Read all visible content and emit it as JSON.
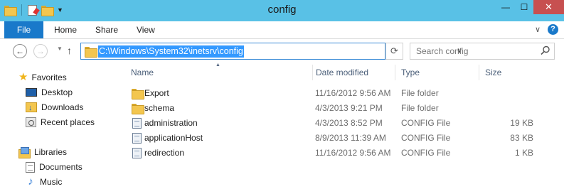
{
  "window": {
    "title": "config",
    "minimize": "—",
    "maximize": "☐",
    "close": "✕"
  },
  "ribbon": {
    "tabs": [
      "File",
      "Home",
      "Share",
      "View"
    ],
    "expand_icon": "chevron-down-icon",
    "help_label": "?"
  },
  "address": {
    "path": "C:\\Windows\\System32\\inetsrv\\config",
    "search_placeholder": "Search config"
  },
  "nav_pane": {
    "favorites_label": "Favorites",
    "favorites": [
      "Desktop",
      "Downloads",
      "Recent places"
    ],
    "libraries_label": "Libraries",
    "libraries": [
      "Documents",
      "Music"
    ]
  },
  "columns": [
    "Name",
    "Date modified",
    "Type",
    "Size"
  ],
  "files": [
    {
      "name": "Export",
      "date": "11/16/2012 9:56 AM",
      "type": "File folder",
      "size": "",
      "icon": "folder-icon"
    },
    {
      "name": "schema",
      "date": "4/3/2013 9:21 PM",
      "type": "File folder",
      "size": "",
      "icon": "folder-icon"
    },
    {
      "name": "administration",
      "date": "4/3/2013 8:52 PM",
      "type": "CONFIG File",
      "size": "19 KB",
      "icon": "config-file-icon"
    },
    {
      "name": "applicationHost",
      "date": "8/9/2013 11:39 AM",
      "type": "CONFIG File",
      "size": "83 KB",
      "icon": "config-file-icon"
    },
    {
      "name": "redirection",
      "date": "11/16/2012 9:56 AM",
      "type": "CONFIG File",
      "size": "1 KB",
      "icon": "config-file-icon"
    }
  ],
  "colors": {
    "titlebar": "#59c1e6",
    "file_tab": "#1979ca",
    "close_button": "#c75050",
    "selection": "#3399ff"
  }
}
